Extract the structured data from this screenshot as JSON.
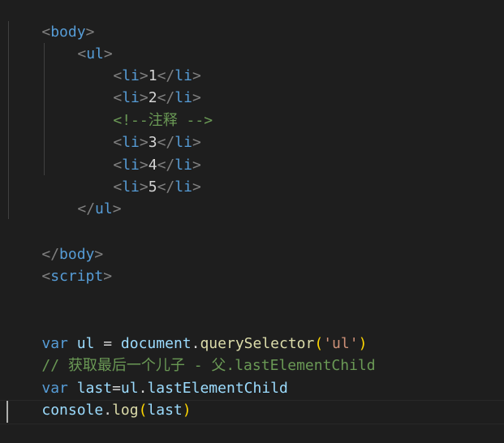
{
  "editor": {
    "lines": {
      "l1": {
        "open": "<",
        "tag": "body",
        "close": ">"
      },
      "l2": {
        "open": "<",
        "tag": "ul",
        "close": ">"
      },
      "l3": {
        "open": "<",
        "tag": "li",
        "close": ">",
        "text": "1",
        "end_open": "</",
        "end_tag": "li",
        "end_close": ">"
      },
      "l4": {
        "open": "<",
        "tag": "li",
        "close": ">",
        "text": "2",
        "end_open": "</",
        "end_tag": "li",
        "end_close": ">"
      },
      "l5": {
        "comment": "<!--注释 -->"
      },
      "l6": {
        "open": "<",
        "tag": "li",
        "close": ">",
        "text": "3",
        "end_open": "</",
        "end_tag": "li",
        "end_close": ">"
      },
      "l7": {
        "open": "<",
        "tag": "li",
        "close": ">",
        "text": "4",
        "end_open": "</",
        "end_tag": "li",
        "end_close": ">"
      },
      "l8": {
        "open": "<",
        "tag": "li",
        "close": ">",
        "text": "5",
        "end_open": "</",
        "end_tag": "li",
        "end_close": ">"
      },
      "l9": {
        "end_open": "</",
        "end_tag": "ul",
        "end_close": ">"
      },
      "l11": {
        "end_open": "</",
        "end_tag": "body",
        "end_close": ">"
      },
      "l12": {
        "open": "<",
        "tag": "script",
        "close": ">"
      },
      "l15": {
        "kw": "var",
        "sp1": " ",
        "var": "ul",
        "op": " = ",
        "obj": "document",
        "dot": ".",
        "fn": "querySelector",
        "lp": "(",
        "str": "'ul'",
        "rp": ")"
      },
      "l16": {
        "comment": "// 获取最后一个儿子 - 父.lastElementChild"
      },
      "l17": {
        "kw": "var",
        "sp1": " ",
        "var": "last",
        "op": "=",
        "obj": "ul",
        "dot": ".",
        "prop": "lastElementChild"
      },
      "l18": {
        "obj": "console",
        "dot": ".",
        "fn": "log",
        "lp": "(",
        "arg": "last",
        "rp": ")"
      }
    }
  },
  "colors": {
    "background": "#1e1e1e",
    "punctuation": "#808080",
    "tag": "#569cd6",
    "text": "#d4d4d4",
    "comment": "#6a9955",
    "keyword": "#569cd6",
    "variable": "#9cdcfe",
    "function": "#dcdcaa",
    "string": "#ce9178",
    "bracket": "#ffd700"
  }
}
